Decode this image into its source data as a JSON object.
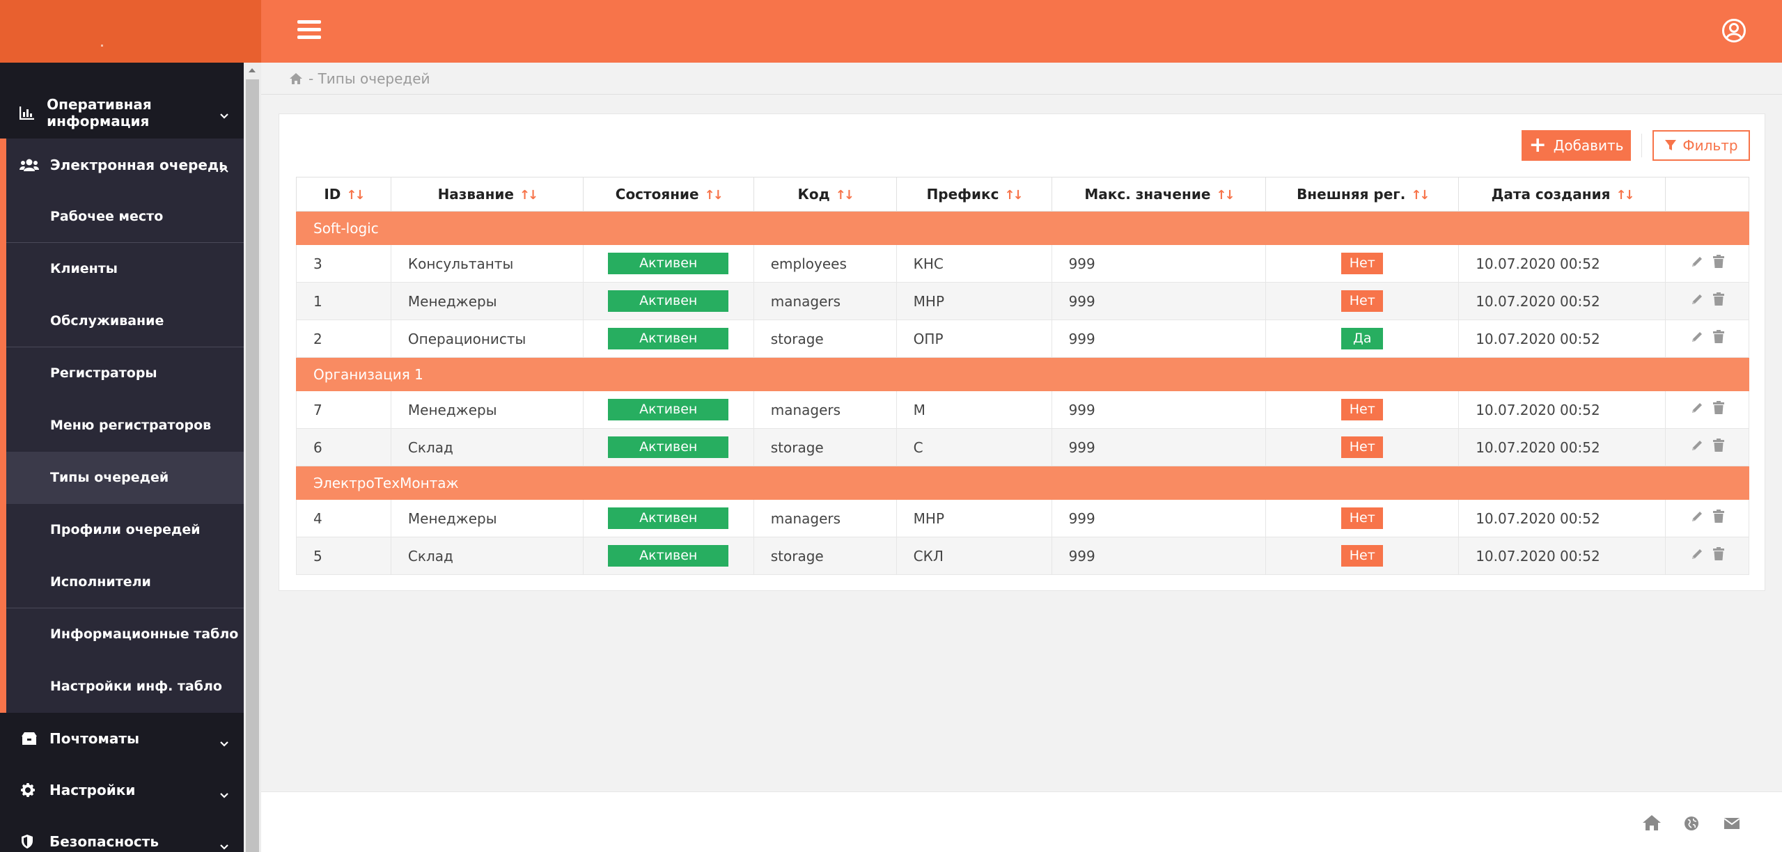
{
  "breadcrumb": {
    "text": "- Типы очередей"
  },
  "sidebar": {
    "top_item": "Оперативная информация",
    "group": {
      "label": "Электронная очередь",
      "items": [
        "Рабочее место",
        "Клиенты",
        "Обслуживание",
        "Регистраторы",
        "Меню регистраторов",
        "Типы очередей",
        "Профили очередей",
        "Исполнители",
        "Информационные табло",
        "Настройки инф. табло"
      ]
    },
    "bottom_items": [
      "Почтоматы",
      "Настройки",
      "Безопасность"
    ]
  },
  "toolbar": {
    "add_label": "Добавить",
    "filter_label": "Фильтр"
  },
  "table": {
    "columns": [
      "ID",
      "Название",
      "Состояние",
      "Код",
      "Префикс",
      "Макс. значение",
      "Внешняя рег.",
      "Дата создания"
    ],
    "groups": [
      {
        "name": "Soft-logic",
        "rows": [
          {
            "id": "3",
            "name": "Консультанты",
            "state": "Активен",
            "code": "employees",
            "prefix": "КНС",
            "max": "999",
            "ext": "Нет",
            "ext_yes": false,
            "date": "10.07.2020 00:52"
          },
          {
            "id": "1",
            "name": "Менеджеры",
            "state": "Активен",
            "code": "managers",
            "prefix": "МНР",
            "max": "999",
            "ext": "Нет",
            "ext_yes": false,
            "date": "10.07.2020 00:52"
          },
          {
            "id": "2",
            "name": "Операционисты",
            "state": "Активен",
            "code": "storage",
            "prefix": "ОПР",
            "max": "999",
            "ext": "Да",
            "ext_yes": true,
            "date": "10.07.2020 00:52"
          }
        ]
      },
      {
        "name": "Организация 1",
        "rows": [
          {
            "id": "7",
            "name": "Менеджеры",
            "state": "Активен",
            "code": "managers",
            "prefix": "М",
            "max": "999",
            "ext": "Нет",
            "ext_yes": false,
            "date": "10.07.2020 00:52"
          },
          {
            "id": "6",
            "name": "Склад",
            "state": "Активен",
            "code": "storage",
            "prefix": "С",
            "max": "999",
            "ext": "Нет",
            "ext_yes": false,
            "date": "10.07.2020 00:52"
          }
        ]
      },
      {
        "name": "ЭлектроТехМонтаж",
        "rows": [
          {
            "id": "4",
            "name": "Менеджеры",
            "state": "Активен",
            "code": "managers",
            "prefix": "МНР",
            "max": "999",
            "ext": "Нет",
            "ext_yes": false,
            "date": "10.07.2020 00:52"
          },
          {
            "id": "5",
            "name": "Склад",
            "state": "Активен",
            "code": "storage",
            "prefix": "СКЛ",
            "max": "999",
            "ext": "Нет",
            "ext_yes": false,
            "date": "10.07.2020 00:52"
          }
        ]
      }
    ]
  },
  "colors": {
    "accent": "#f7744a",
    "group_row": "#f98b62",
    "success": "#27ae60",
    "sidebar": "#1a1a22"
  },
  "icons": {
    "menu": "hamburger-icon",
    "user": "user-circle-icon",
    "home": "home-icon",
    "edit": "pencil-icon",
    "delete": "trash-icon",
    "globe": "globe-icon",
    "mail": "mail-icon"
  }
}
